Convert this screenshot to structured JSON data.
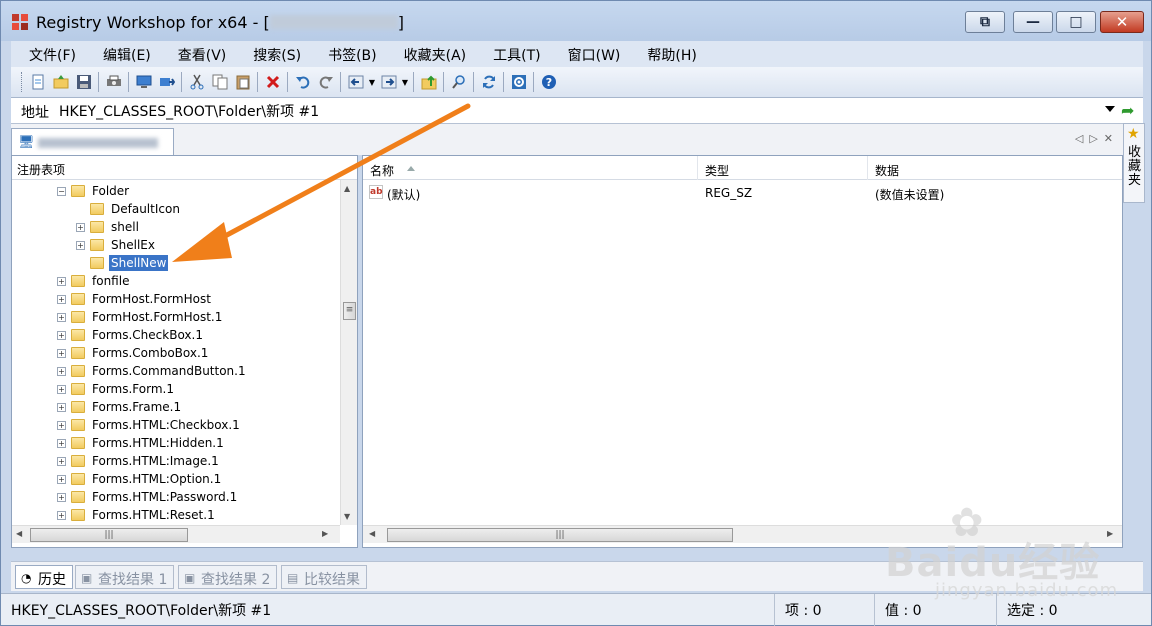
{
  "window": {
    "title": "Registry Workshop for x64 - [",
    "title_suffix": "]",
    "controls": {
      "restore": "⧉",
      "minimize": "—",
      "maximize": "□",
      "close": "✕"
    }
  },
  "menu": [
    "文件(F)",
    "编辑(E)",
    "查看(V)",
    "搜索(S)",
    "书签(B)",
    "收藏夹(A)",
    "工具(T)",
    "窗口(W)",
    "帮助(H)"
  ],
  "toolbar": {
    "icons": [
      "new-file-icon",
      "open-icon",
      "save-icon",
      "print-icon",
      "computer-icon",
      "connect-icon",
      "cut-icon",
      "copy-icon",
      "paste-icon",
      "delete-icon",
      "undo-icon",
      "redo-icon",
      "back-icon",
      "forward-icon",
      "up-folder-icon",
      "find-icon",
      "refresh-icon",
      "settings-icon",
      "help-icon"
    ]
  },
  "address": {
    "label": "地址",
    "value": "HKEY_CLASSES_ROOT\\Folder\\新项 #1"
  },
  "favorites": {
    "label": "收藏夹"
  },
  "tree": {
    "header": "注册表项",
    "items": [
      {
        "label": "Folder",
        "expanded": true
      },
      {
        "label": "DefaultIcon"
      },
      {
        "label": "shell"
      },
      {
        "label": "ShellEx"
      },
      {
        "label": "ShellNew",
        "selected": true
      },
      {
        "label": "fonfile"
      },
      {
        "label": "FormHost.FormHost"
      },
      {
        "label": "FormHost.FormHost.1"
      },
      {
        "label": "Forms.CheckBox.1"
      },
      {
        "label": "Forms.ComboBox.1"
      },
      {
        "label": "Forms.CommandButton.1"
      },
      {
        "label": "Forms.Form.1"
      },
      {
        "label": "Forms.Frame.1"
      },
      {
        "label": "Forms.HTML:Checkbox.1"
      },
      {
        "label": "Forms.HTML:Hidden.1"
      },
      {
        "label": "Forms.HTML:Image.1"
      },
      {
        "label": "Forms.HTML:Option.1"
      },
      {
        "label": "Forms.HTML:Password.1"
      },
      {
        "label": "Forms.HTML:Reset.1"
      }
    ]
  },
  "list": {
    "columns": [
      "名称",
      "类型",
      "数据"
    ],
    "rows": [
      {
        "icon": "ab",
        "name": "(默认)",
        "type": "REG_SZ",
        "data": "(数值未设置)"
      }
    ]
  },
  "bottom_tabs": [
    "历史",
    "查找结果 1",
    "查找结果 2",
    "比较结果"
  ],
  "status": {
    "path": "HKEY_CLASSES_ROOT\\Folder\\新项 #1",
    "items": "项 : 0",
    "values": "值 : 0",
    "selected": "选定 : 0"
  },
  "watermark": {
    "brand": "Baidu经验",
    "url": "jingyan.baidu.com"
  },
  "colors": {
    "selection": "#3a74c7",
    "arrow": "#f07f1a",
    "title_bg": "#c6d8ef"
  }
}
